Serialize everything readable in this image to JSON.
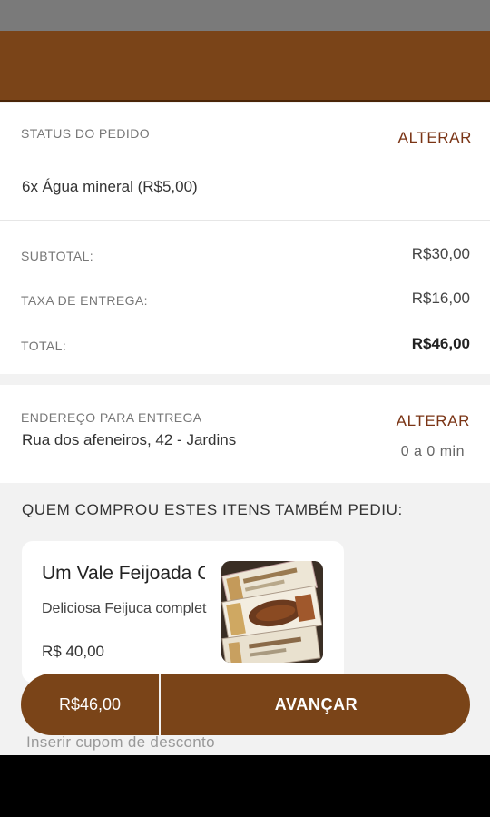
{
  "order": {
    "status_label": "STATUS DO PEDIDO",
    "change_label": "ALTERAR",
    "item": "6x Água mineral (R$5,00)"
  },
  "totals": {
    "subtotal_label": "SUBTOTAL:",
    "subtotal_value": "R$30,00",
    "fee_label": "TAXA DE ENTREGA:",
    "fee_value": "R$16,00",
    "total_label": "TOTAL:",
    "total_value": "R$46,00"
  },
  "address": {
    "label": "ENDEREÇO PARA ENTREGA",
    "change_label": "ALTERAR",
    "value": "Rua dos afeneiros, 42 - Jardins",
    "eta": "0 a 0 min"
  },
  "recommendations": {
    "title": "QUEM COMPROU ESTES ITENS TAMBÉM PEDIU:",
    "items": [
      {
        "name": "Um Vale Feijoada Completa",
        "description": "Deliciosa Feijuca completa",
        "price": "R$ 40,00"
      }
    ]
  },
  "checkout": {
    "total": "R$46,00",
    "next_label": "AVANÇAR"
  },
  "coupon": {
    "placeholder": "Inserir cupom de desconto"
  },
  "colors": {
    "brand": "#7a4418",
    "accent_link": "#7a3415"
  }
}
